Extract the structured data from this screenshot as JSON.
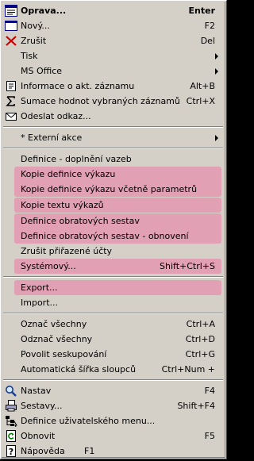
{
  "menu": {
    "oprava": {
      "label": "Oprava...",
      "shortcut": "Enter"
    },
    "novy": {
      "label": "Nový...",
      "shortcut": "F2"
    },
    "zrusit": {
      "label": "Zrušit",
      "shortcut": "Del"
    },
    "tisk": {
      "label": "Tisk"
    },
    "ms_office": {
      "label": "MS Office"
    },
    "informace": {
      "label": "Informace o akt. záznamu",
      "shortcut": "Alt+B"
    },
    "sumace": {
      "label": "Sumace hodnot vybraných záznamů",
      "shortcut": "Ctrl+X"
    },
    "odeslat": {
      "label": "Odeslat odkaz..."
    },
    "externi": {
      "label": "* Externí akce"
    },
    "definice_vazeb": {
      "label": "Definice - doplnění vazeb"
    },
    "kopie_def": {
      "label": "Kopie definice výkazu"
    },
    "kopie_def_par": {
      "label": "Kopie definice výkazu včetně parametrů"
    },
    "kopie_textu": {
      "label": "Kopie textu výkazů"
    },
    "def_obrat": {
      "label": "Definice obratových sestav"
    },
    "def_obrat_obn": {
      "label": "Definice obratových sestav - obnovení"
    },
    "zrusit_ucty": {
      "label": "Zrušit přiřazené účty"
    },
    "systemovy": {
      "label": "Systémový...",
      "shortcut": "Shift+Ctrl+S"
    },
    "export": {
      "label": "Export..."
    },
    "import": {
      "label": "Import..."
    },
    "oznac": {
      "label": "Označ všechny",
      "shortcut": "Ctrl+A"
    },
    "odznac": {
      "label": "Odznač všechny",
      "shortcut": "Ctrl+D"
    },
    "seskupovani": {
      "label": "Povolit seskupování",
      "shortcut": "Ctrl+G"
    },
    "sirka": {
      "label": "Automatická šířka sloupců",
      "shortcut": "Ctrl+Num +"
    },
    "nastav": {
      "label": "Nastav",
      "shortcut": "F4"
    },
    "sestavy": {
      "label": "Sestavy...",
      "shortcut": "Shift+F4"
    },
    "def_menu": {
      "label": "Definice uživatelského menu..."
    },
    "obnovit": {
      "label": "Obnovit",
      "shortcut": "F5"
    },
    "napoveda": {
      "label": "Nápověda",
      "shortcut": "F1"
    }
  },
  "colors": {
    "menu_bg": "#d4d0c8",
    "highlight": "#e2a0b5"
  }
}
